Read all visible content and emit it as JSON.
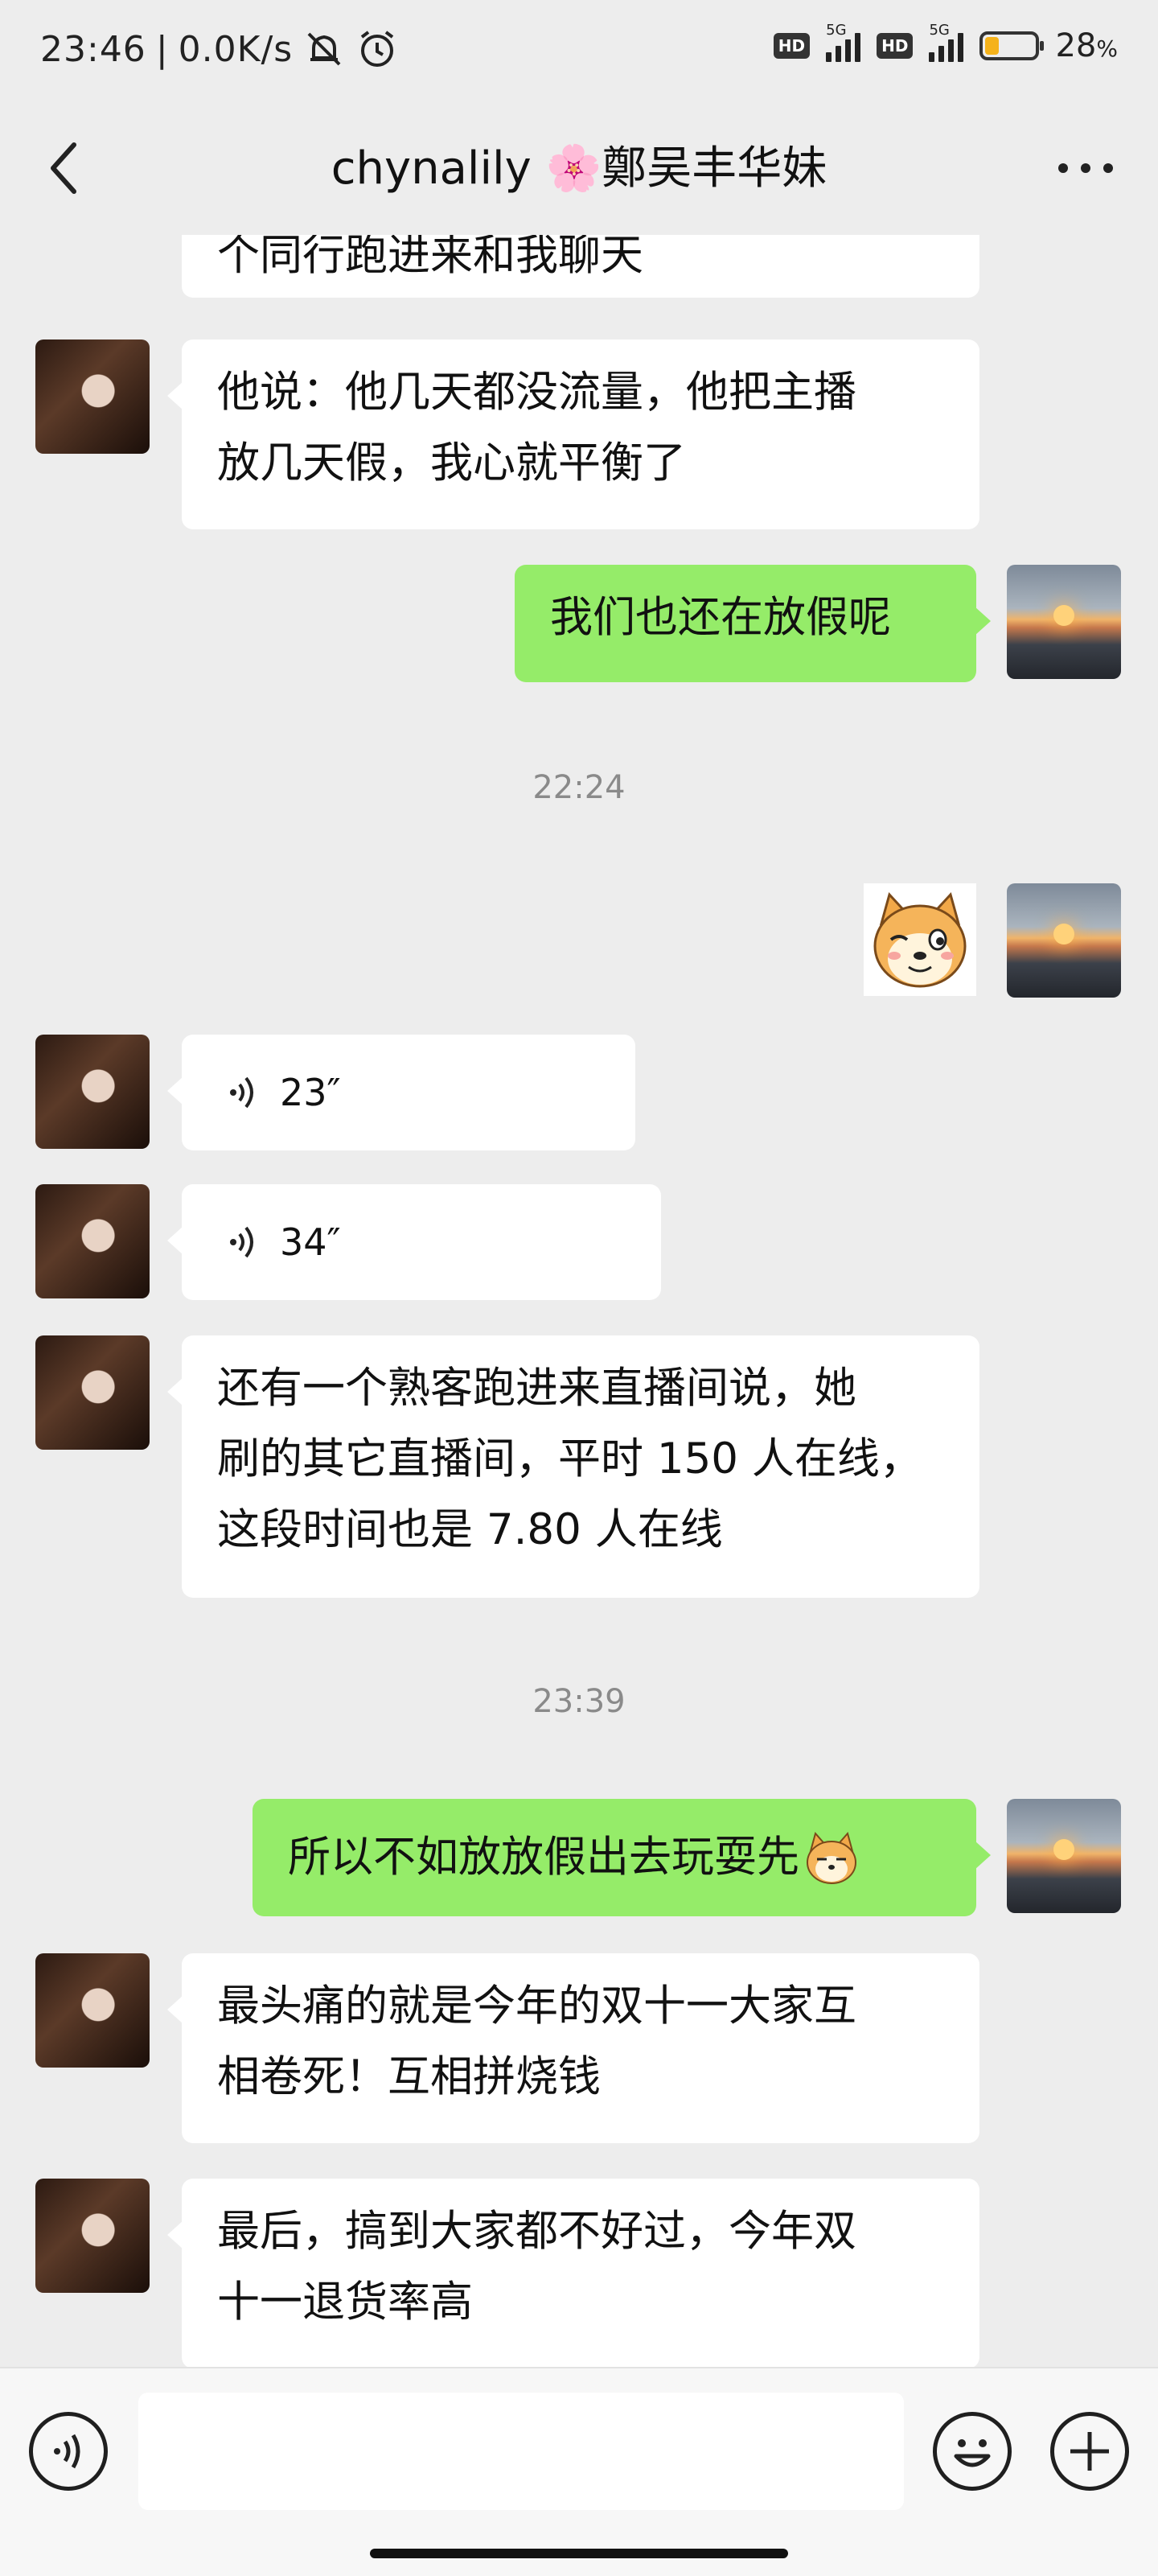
{
  "status_bar": {
    "time": "23:46",
    "net_speed": "0.0K/s",
    "hd1": "HD",
    "net1": "5G",
    "hd2": "HD",
    "net2": "5G",
    "battery_percent": "28",
    "battery_symbol": "%",
    "battery_level": 0.28
  },
  "header": {
    "title_name": "chynalily",
    "title_flower": "🌸",
    "title_rest": "鄭吴丰华妹"
  },
  "chat": {
    "messages": [
      {
        "side": "in",
        "type": "text",
        "text": "个同行跑进来和我聊天"
      },
      {
        "side": "in",
        "type": "text",
        "lines": [
          "他说：他几天都没流量，他把主播",
          "放几天假，我心就平衡了"
        ]
      },
      {
        "side": "out",
        "type": "text",
        "text": "我们也还在放假呢"
      },
      {
        "type": "time",
        "text": "22:24"
      },
      {
        "side": "out",
        "type": "sticker",
        "sticker": "shiba-dog-sticker"
      },
      {
        "side": "in",
        "type": "voice",
        "duration": "23″"
      },
      {
        "side": "in",
        "type": "voice",
        "duration": "34″"
      },
      {
        "side": "in",
        "type": "text",
        "lines": [
          "还有一个熟客跑进来直播间说，她",
          "刷的其它直播间，平时 150 人在线，",
          "这段时间也是 7.80 人在线"
        ]
      },
      {
        "type": "time",
        "text": "23:39"
      },
      {
        "side": "out",
        "type": "text",
        "text": "所以不如放放假出去玩耍先"
      },
      {
        "side": "in",
        "type": "text",
        "lines": [
          "最头痛的就是今年的双十一大家互",
          "相卷死！互相拼烧钱"
        ]
      },
      {
        "side": "in",
        "type": "text",
        "lines": [
          "最后，搞到大家都不好过，今年双",
          "十一退货率高"
        ]
      }
    ]
  },
  "input_bar": {
    "placeholder": ""
  },
  "colors": {
    "background": "#ededed",
    "bubble_in": "#ffffff",
    "bubble_out": "#95ec69",
    "time_text": "#8a8a8a"
  }
}
